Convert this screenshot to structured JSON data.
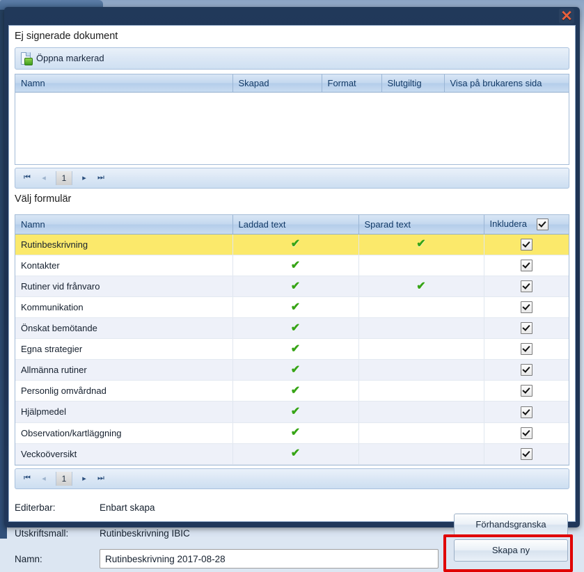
{
  "window": {
    "close_label": "✕",
    "close_icon": "close-icon"
  },
  "documents_section": {
    "title": "Ej signerade dokument",
    "toolbar": {
      "open_marked_label": "Öppna markerad",
      "open_marked_icon": "document-open-icon"
    },
    "columns": [
      "Namn",
      "Skapad",
      "Format",
      "Slutgiltig",
      "Visa på brukarens sida"
    ],
    "rows": [],
    "pager": {
      "first": "⏮",
      "prev": "◂",
      "page": "1",
      "next": "▸",
      "last": "⏭"
    }
  },
  "forms_section": {
    "title": "Välj formulär",
    "columns": {
      "name": "Namn",
      "loaded_text": "Laddad text",
      "saved_text": "Sparad text",
      "include": "Inkludera"
    },
    "header_include_checked": true,
    "rows": [
      {
        "name": "Rutinbeskrivning",
        "loaded": true,
        "saved": true,
        "include": true,
        "selected": true
      },
      {
        "name": "Kontakter",
        "loaded": true,
        "saved": false,
        "include": true,
        "selected": false
      },
      {
        "name": "Rutiner vid frånvaro",
        "loaded": true,
        "saved": true,
        "include": true,
        "selected": false
      },
      {
        "name": "Kommunikation",
        "loaded": true,
        "saved": false,
        "include": true,
        "selected": false
      },
      {
        "name": "Önskat bemötande",
        "loaded": true,
        "saved": false,
        "include": true,
        "selected": false
      },
      {
        "name": "Egna strategier",
        "loaded": true,
        "saved": false,
        "include": true,
        "selected": false
      },
      {
        "name": "Allmänna rutiner",
        "loaded": true,
        "saved": false,
        "include": true,
        "selected": false
      },
      {
        "name": "Personlig omvårdnad",
        "loaded": true,
        "saved": false,
        "include": true,
        "selected": false
      },
      {
        "name": "Hjälpmedel",
        "loaded": true,
        "saved": false,
        "include": true,
        "selected": false
      },
      {
        "name": "Observation/kartläggning",
        "loaded": true,
        "saved": false,
        "include": true,
        "selected": false
      },
      {
        "name": "Veckoöversikt",
        "loaded": true,
        "saved": false,
        "include": true,
        "selected": false
      }
    ],
    "pager": {
      "first": "⏮",
      "prev": "◂",
      "page": "1",
      "next": "▸",
      "last": "⏭"
    }
  },
  "footer": {
    "editerbar_label": "Editerbar:",
    "editerbar_value": "Enbart skapa",
    "utskriftsmall_label": "Utskriftsmall:",
    "utskriftsmall_value": "Rutinbeskrivning IBIC",
    "namn_label": "Namn:",
    "namn_value": "Rutinbeskrivning 2017-08-28",
    "namn_placeholder": "",
    "preview_button": "Förhandsgranska",
    "create_button": "Skapa ny"
  },
  "colors": {
    "dialog_chrome": "#1d3557",
    "selected_row": "#fbe96b",
    "tick_green": "#36a416",
    "highlight_red": "#e00000",
    "close_red": "#e8603c"
  },
  "tick_glyph": "✔"
}
